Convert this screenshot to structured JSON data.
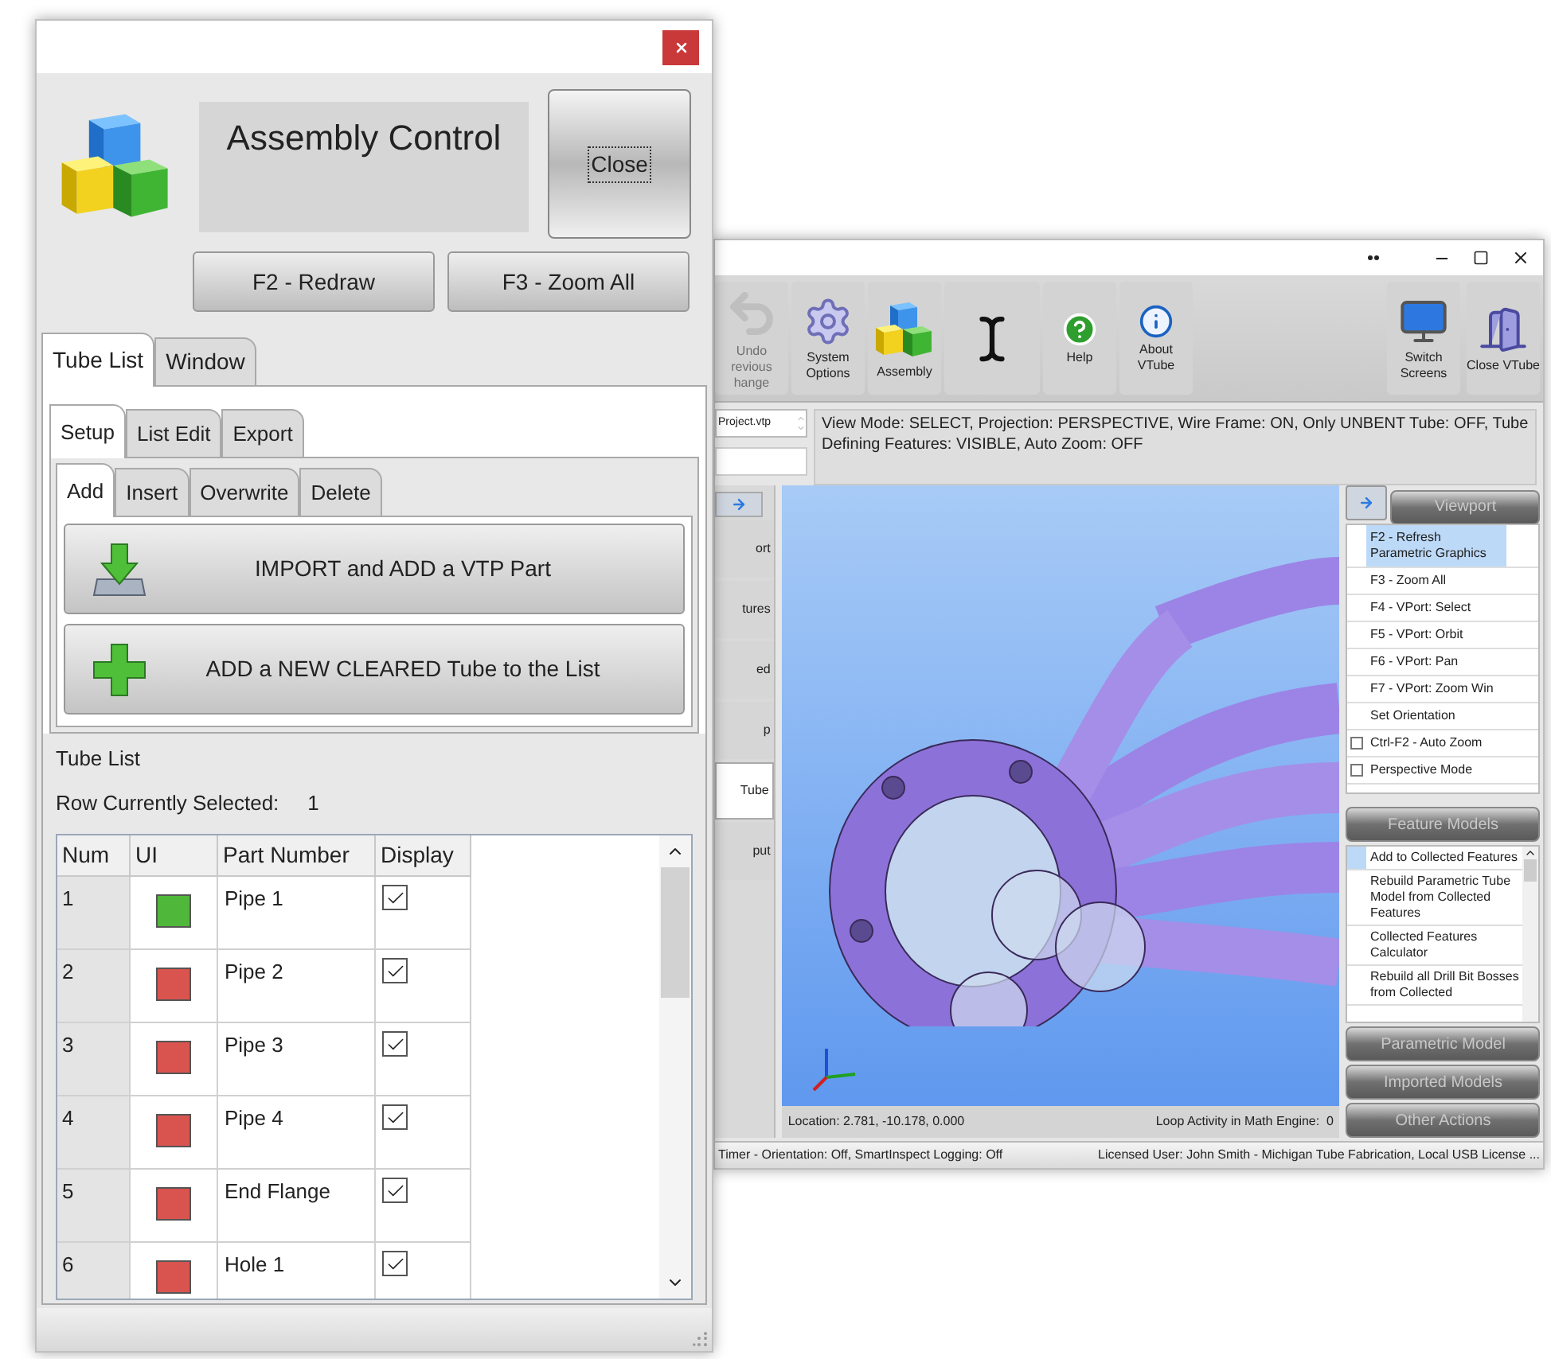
{
  "assembly_window": {
    "title": "Assembly Control",
    "close_button": "Close",
    "buttons": [
      "F2 - Redraw",
      "F3 - Zoom All"
    ],
    "tabs": [
      {
        "label": "Tube List",
        "selected": true
      },
      {
        "label": "Window",
        "selected": false
      }
    ],
    "subtabs": [
      {
        "label": "Setup",
        "selected": true
      },
      {
        "label": "List Edit",
        "selected": false
      },
      {
        "label": "Export",
        "selected": false
      }
    ],
    "action_tabs": [
      {
        "label": "Add",
        "selected": true
      },
      {
        "label": "Insert",
        "selected": false
      },
      {
        "label": "Overwrite",
        "selected": false
      },
      {
        "label": "Delete",
        "selected": false
      }
    ],
    "actions": [
      {
        "kind": "import",
        "label": "IMPORT and ADD a VTP Part"
      },
      {
        "kind": "add",
        "label": "ADD a NEW CLEARED Tube to the List"
      }
    ],
    "list_title": "Tube List",
    "row_selected_label": "Row Currently Selected:",
    "row_selected_value": "1",
    "table": {
      "columns": [
        "Num",
        "UI",
        "Part Number",
        "Display"
      ],
      "rows": [
        {
          "num": "1",
          "color": "#4fb83a",
          "part": "Pipe 1",
          "display": true
        },
        {
          "num": "2",
          "color": "#d9534f",
          "part": "Pipe 2",
          "display": true
        },
        {
          "num": "3",
          "color": "#d9534f",
          "part": "Pipe 3",
          "display": true
        },
        {
          "num": "4",
          "color": "#d9534f",
          "part": "Pipe 4",
          "display": true
        },
        {
          "num": "5",
          "color": "#d9534f",
          "part": "End Flange",
          "display": true
        },
        {
          "num": "6",
          "color": "#d9534f",
          "part": "Hole 1",
          "display": true
        }
      ]
    }
  },
  "main_window": {
    "toolbar": [
      {
        "kind": "undo",
        "label": "Undo\nrevious\nhange",
        "disabled": true
      },
      {
        "kind": "settings",
        "label": "System Options",
        "disabled": false
      },
      {
        "kind": "assembly",
        "label": "Assembly",
        "disabled": false
      },
      {
        "kind": "cursor",
        "disabled": false
      },
      {
        "kind": "help",
        "label": "Help",
        "disabled": false
      },
      {
        "kind": "about",
        "label": "About VTube",
        "disabled": false
      }
    ],
    "toolbar_right": [
      {
        "kind": "screens",
        "label": "Switch Screens"
      },
      {
        "kind": "exit",
        "label": "Close VTube"
      }
    ],
    "file_field": "Project.vtp",
    "status_text": "View Mode: SELECT, Projection: PERSPECTIVE, Wire Frame: ON, Only UNBENT Tube: OFF, Tube Defining Features: VISIBLE, Auto Zoom: OFF",
    "side_items": [
      {
        "label": "ort",
        "selected": false
      },
      {
        "label": "tures",
        "selected": false
      },
      {
        "label": "ed",
        "selected": false
      },
      {
        "label": "p",
        "selected": false
      },
      {
        "label": "Tube",
        "selected": true
      },
      {
        "label": "put",
        "selected": false
      }
    ],
    "location": "Location: 2.781, -10.178, 0.000",
    "loop_activity": "Loop Activity in Math Engine:  0",
    "right_panel": {
      "viewport_header": "Viewport",
      "viewport_items": [
        {
          "kind": "command",
          "label": "F2 - Refresh Parametric Graphics",
          "selected": true
        },
        {
          "kind": "command",
          "label": "F3 - Zoom All",
          "selected": false
        },
        {
          "kind": "command",
          "label": "F4 - VPort: Select",
          "selected": false
        },
        {
          "kind": "command",
          "label": "F5 - VPort: Orbit",
          "selected": false
        },
        {
          "kind": "command",
          "label": "F6 - VPort: Pan",
          "selected": false
        },
        {
          "kind": "command",
          "label": "F7 - VPort: Zoom Win",
          "selected": false
        },
        {
          "kind": "command",
          "label": "Set Orientation",
          "selected": false
        },
        {
          "kind": "checkbox",
          "label": "Ctrl-F2 - Auto Zoom",
          "selected": false,
          "checked": false
        },
        {
          "kind": "checkbox",
          "label": "Perspective Mode",
          "selected": false,
          "checked": false
        }
      ],
      "feature_header": "Feature Models",
      "feature_items": [
        {
          "label": "Add to Collected Features",
          "selected": true
        },
        {
          "label": "Rebuild Parametric Tube Model from Collected Features",
          "selected": false
        },
        {
          "label": "Collected Features Calculator",
          "selected": false
        },
        {
          "label": "Rebuild all Drill Bit Bosses from Collected",
          "selected": false
        }
      ],
      "sections": [
        "Parametric Model",
        "Imported Models",
        "Other Actions"
      ]
    },
    "status_bar": [
      "Timer - Orientation: Off, SmartInspect Logging: Off",
      "Licensed User: John Smith - Michigan Tube Fabrication, Local USB License ..."
    ]
  }
}
